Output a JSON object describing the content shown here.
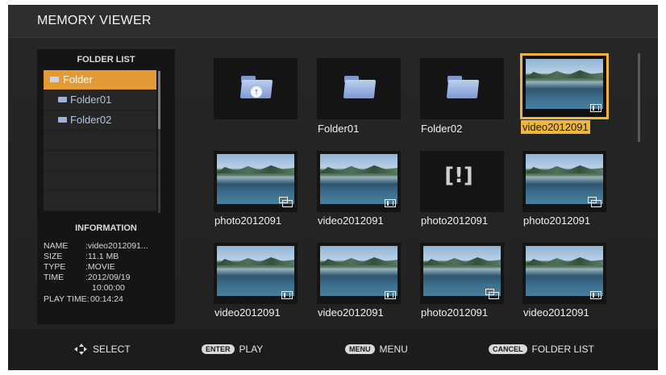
{
  "header": {
    "title": "MEMORY VIEWER"
  },
  "folder_list": {
    "title": "FOLDER LIST",
    "items": [
      {
        "label": "Folder",
        "selected": true
      },
      {
        "label": "Folder01",
        "selected": false
      },
      {
        "label": "Folder02",
        "selected": false
      }
    ]
  },
  "information": {
    "title": "INFORMATION",
    "name_label": "NAME",
    "name_value": ":video2012091...",
    "size_label": "SIZE",
    "size_value": ":11.1 MB",
    "type_label": "TYPE",
    "type_value": ":MOVIE",
    "time_label": "TIME",
    "time_value": ":2012/09/19",
    "time_value2": "10:00:00",
    "play_time_label": "PLAY TIME:",
    "play_time_value": "00:14:24"
  },
  "grid": {
    "row1": [
      {
        "type": "folder-up",
        "caption": ""
      },
      {
        "type": "folder",
        "caption": "Folder01"
      },
      {
        "type": "folder",
        "caption": "Folder02"
      },
      {
        "type": "video",
        "caption": "video2012091",
        "selected": true
      }
    ],
    "row2": [
      {
        "type": "photo",
        "caption": "photo2012091"
      },
      {
        "type": "video",
        "caption": "video2012091"
      },
      {
        "type": "error",
        "caption": "photo2012091"
      },
      {
        "type": "photo",
        "caption": "photo2012091"
      }
    ],
    "row3": [
      {
        "type": "video",
        "caption": "video2012091"
      },
      {
        "type": "video",
        "caption": "video2012091"
      },
      {
        "type": "photo",
        "caption": "photo2012091"
      },
      {
        "type": "video",
        "caption": "video2012091"
      }
    ]
  },
  "footer": {
    "select_label": "SELECT",
    "enter_key": "ENTER",
    "enter_label": "PLAY",
    "menu_key": "MENU",
    "menu_label": "MENU",
    "cancel_key": "CANCEL",
    "cancel_label": "FOLDER LIST"
  },
  "colors": {
    "accent": "#f0b63c",
    "selected_folder": "#e39a36"
  }
}
